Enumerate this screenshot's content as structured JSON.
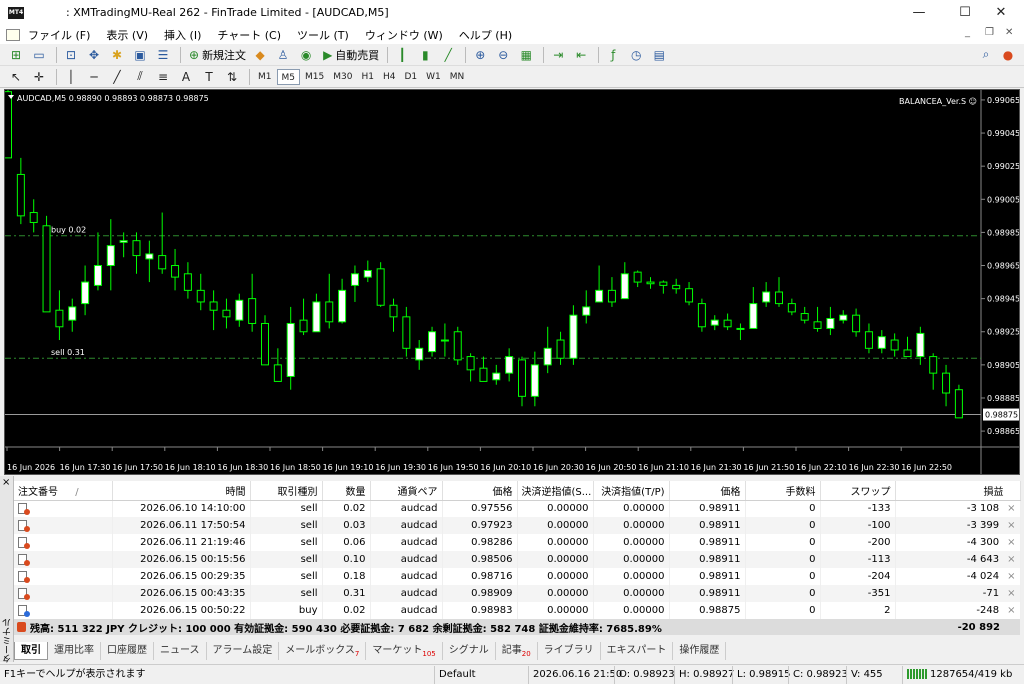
{
  "window": {
    "title": ": XMTradingMU-Real 262 - FinTrade Limited - [AUDCAD,M5]",
    "app_icon_text": "MT4",
    "controls": {
      "minimize": "—",
      "maximize": "☐",
      "close": "✕"
    }
  },
  "menu": [
    "ファイル (F)",
    "表示 (V)",
    "挿入 (I)",
    "チャート (C)",
    "ツール (T)",
    "ウィンドウ (W)",
    "ヘルプ (H)"
  ],
  "toolbar": {
    "new_order": "新規注文",
    "auto_trading": "自動売買",
    "timeframes": [
      "M1",
      "M5",
      "M15",
      "M30",
      "H1",
      "H4",
      "D1",
      "W1",
      "MN"
    ],
    "active_timeframe": "M5",
    "drawing_tool_A": "A"
  },
  "chart": {
    "header": "AUDCAD,M5  0.98890 0.98893 0.98873 0.98875",
    "ea_label": "BALANCEA_Ver.S ☺",
    "buy_label": "buy 0.02",
    "sell_label": "sell 0.31",
    "current_price_label": "0.98875",
    "colors": {
      "background": "#000000",
      "up": "#ffffff",
      "down": "#000000",
      "wick": "#00ff00",
      "level": "#2e8b2e",
      "text": "#ffffff"
    }
  },
  "chart_data": {
    "type": "candlestick",
    "symbol": "AUDCAD",
    "timeframe": "M5",
    "ylim": [
      0.98856,
      0.99071
    ],
    "y_ticks": [
      "0.99065",
      "0.99045",
      "0.99025",
      "0.99005",
      "0.98985",
      "0.98965",
      "0.98945",
      "0.98925",
      "0.98905",
      "0.98885",
      "0.98865"
    ],
    "x_ticks": [
      "16 Jun 2026",
      "16 Jun 17:30",
      "16 Jun 17:50",
      "16 Jun 18:10",
      "16 Jun 18:30",
      "16 Jun 18:50",
      "16 Jun 19:10",
      "16 Jun 19:30",
      "16 Jun 19:50",
      "16 Jun 20:10",
      "16 Jun 20:30",
      "16 Jun 20:50",
      "16 Jun 21:10",
      "16 Jun 21:30",
      "16 Jun 21:50",
      "16 Jun 22:10",
      "16 Jun 22:30",
      "16 Jun 22:50"
    ],
    "buy_level": 0.98983,
    "sell_level": 0.98909,
    "current_price": 0.98875,
    "candles": [
      [
        0.9907,
        0.9903,
        0.99071,
        0.9903
      ],
      [
        0.9902,
        0.98995,
        0.9903,
        0.9899
      ],
      [
        0.98997,
        0.98991,
        0.99005,
        0.98985
      ],
      [
        0.98989,
        0.98937,
        0.98995,
        0.98937
      ],
      [
        0.98938,
        0.98928,
        0.9895,
        0.9892
      ],
      [
        0.98932,
        0.9894,
        0.98945,
        0.98925
      ],
      [
        0.98942,
        0.98955,
        0.98965,
        0.98935
      ],
      [
        0.98953,
        0.98965,
        0.98985,
        0.9895
      ],
      [
        0.98965,
        0.98977,
        0.98993,
        0.9895
      ],
      [
        0.98979,
        0.9898,
        0.98985,
        0.9897
      ],
      [
        0.9898,
        0.98971,
        0.98985,
        0.9896
      ],
      [
        0.98969,
        0.98972,
        0.9898,
        0.98955
      ],
      [
        0.98971,
        0.98963,
        0.98997,
        0.9896
      ],
      [
        0.98965,
        0.98958,
        0.98975,
        0.9895
      ],
      [
        0.9896,
        0.9895,
        0.98967,
        0.98945
      ],
      [
        0.9895,
        0.98943,
        0.9896,
        0.98938
      ],
      [
        0.98943,
        0.98938,
        0.9895,
        0.98926
      ],
      [
        0.98938,
        0.98934,
        0.98945,
        0.98927
      ],
      [
        0.98932,
        0.98944,
        0.98948,
        0.98928
      ],
      [
        0.98945,
        0.9893,
        0.9896,
        0.98925
      ],
      [
        0.9893,
        0.98905,
        0.98935,
        0.98905
      ],
      [
        0.98905,
        0.98895,
        0.98915,
        0.98895
      ],
      [
        0.98898,
        0.9893,
        0.9894,
        0.9889
      ],
      [
        0.98932,
        0.98925,
        0.98945,
        0.98923
      ],
      [
        0.98925,
        0.98943,
        0.98948,
        0.98925
      ],
      [
        0.98943,
        0.98931,
        0.9896,
        0.98927
      ],
      [
        0.98931,
        0.9895,
        0.98957,
        0.9893
      ],
      [
        0.98953,
        0.9896,
        0.98965,
        0.98943
      ],
      [
        0.98958,
        0.98962,
        0.98968,
        0.98955
      ],
      [
        0.98963,
        0.98941,
        0.98967,
        0.9894
      ],
      [
        0.98941,
        0.98934,
        0.98945,
        0.98925
      ],
      [
        0.98934,
        0.98915,
        0.9894,
        0.9891
      ],
      [
        0.98908,
        0.98915,
        0.9892,
        0.98902
      ],
      [
        0.98913,
        0.98925,
        0.98928,
        0.9891
      ],
      [
        0.9892,
        0.9892,
        0.9893,
        0.9891
      ],
      [
        0.98925,
        0.98908,
        0.98928,
        0.98905
      ],
      [
        0.9891,
        0.98902,
        0.98912,
        0.98895
      ],
      [
        0.98903,
        0.98895,
        0.9891,
        0.98895
      ],
      [
        0.98896,
        0.989,
        0.98905,
        0.98893
      ],
      [
        0.989,
        0.9891,
        0.98915,
        0.98895
      ],
      [
        0.98908,
        0.98886,
        0.9891,
        0.9888
      ],
      [
        0.98886,
        0.98905,
        0.98913,
        0.9888
      ],
      [
        0.98905,
        0.98915,
        0.98928,
        0.989
      ],
      [
        0.9892,
        0.98909,
        0.98925,
        0.98905
      ],
      [
        0.98909,
        0.98935,
        0.98941,
        0.98905
      ],
      [
        0.98935,
        0.9894,
        0.9895,
        0.9893
      ],
      [
        0.98943,
        0.9895,
        0.98965,
        0.98943
      ],
      [
        0.9895,
        0.98943,
        0.98958,
        0.9894
      ],
      [
        0.98945,
        0.9896,
        0.98967,
        0.98945
      ],
      [
        0.98961,
        0.98955,
        0.98962,
        0.98952
      ],
      [
        0.98955,
        0.98954,
        0.98958,
        0.98951
      ],
      [
        0.98955,
        0.98953,
        0.98956,
        0.98948
      ],
      [
        0.98953,
        0.98951,
        0.98957,
        0.98948
      ],
      [
        0.98951,
        0.98943,
        0.98955,
        0.98941
      ],
      [
        0.98942,
        0.98928,
        0.98945,
        0.98925
      ],
      [
        0.98929,
        0.98932,
        0.98935,
        0.98926
      ],
      [
        0.98932,
        0.98928,
        0.98936,
        0.98926
      ],
      [
        0.98927,
        0.98927,
        0.9893,
        0.9892
      ],
      [
        0.98927,
        0.98942,
        0.98952,
        0.98927
      ],
      [
        0.98943,
        0.98949,
        0.98955,
        0.9894
      ],
      [
        0.98949,
        0.98942,
        0.98958,
        0.9894
      ],
      [
        0.98942,
        0.98937,
        0.98945,
        0.98935
      ],
      [
        0.98936,
        0.98932,
        0.9894,
        0.9893
      ],
      [
        0.98931,
        0.98927,
        0.9894,
        0.98925
      ],
      [
        0.98927,
        0.98933,
        0.9894,
        0.98923
      ],
      [
        0.98932,
        0.98935,
        0.98938,
        0.9893
      ],
      [
        0.98935,
        0.98925,
        0.98939,
        0.98922
      ],
      [
        0.98925,
        0.98915,
        0.9893,
        0.98912
      ],
      [
        0.98915,
        0.98922,
        0.98926,
        0.98912
      ],
      [
        0.9892,
        0.98914,
        0.98924,
        0.9891
      ],
      [
        0.98914,
        0.9891,
        0.98922,
        0.9891
      ],
      [
        0.9891,
        0.98924,
        0.98928,
        0.98905
      ],
      [
        0.9891,
        0.989,
        0.98912,
        0.9889
      ],
      [
        0.989,
        0.98888,
        0.98905,
        0.9888
      ],
      [
        0.9889,
        0.98873,
        0.98893,
        0.98873
      ]
    ]
  },
  "terminal": {
    "columns": [
      "注文番号",
      "時間",
      "取引種別",
      "数量",
      "通貨ペア",
      "価格",
      "決済逆指値(S...",
      "決済指値(T/P)",
      "価格",
      "手数料",
      "スワップ",
      "損益"
    ],
    "sort_marker": "/",
    "orders": [
      {
        "time": "2026.06.10 14:10:00",
        "type": "sell",
        "size": "0.02",
        "symbol": "audcad",
        "price": "0.97556",
        "sl": "0.00000",
        "tp": "0.00000",
        "cur": "0.98911",
        "commission": "0",
        "swap": "-133",
        "profit": "-3 108"
      },
      {
        "time": "2026.06.11 17:50:54",
        "type": "sell",
        "size": "0.03",
        "symbol": "audcad",
        "price": "0.97923",
        "sl": "0.00000",
        "tp": "0.00000",
        "cur": "0.98911",
        "commission": "0",
        "swap": "-100",
        "profit": "-3 399"
      },
      {
        "time": "2026.06.11 21:19:46",
        "type": "sell",
        "size": "0.06",
        "symbol": "audcad",
        "price": "0.98286",
        "sl": "0.00000",
        "tp": "0.00000",
        "cur": "0.98911",
        "commission": "0",
        "swap": "-200",
        "profit": "-4 300"
      },
      {
        "time": "2026.06.15 00:15:56",
        "type": "sell",
        "size": "0.10",
        "symbol": "audcad",
        "price": "0.98506",
        "sl": "0.00000",
        "tp": "0.00000",
        "cur": "0.98911",
        "commission": "0",
        "swap": "-113",
        "profit": "-4 643"
      },
      {
        "time": "2026.06.15 00:29:35",
        "type": "sell",
        "size": "0.18",
        "symbol": "audcad",
        "price": "0.98716",
        "sl": "0.00000",
        "tp": "0.00000",
        "cur": "0.98911",
        "commission": "0",
        "swap": "-204",
        "profit": "-4 024"
      },
      {
        "time": "2026.06.15 00:43:35",
        "type": "sell",
        "size": "0.31",
        "symbol": "audcad",
        "price": "0.98909",
        "sl": "0.00000",
        "tp": "0.00000",
        "cur": "0.98911",
        "commission": "0",
        "swap": "-351",
        "profit": "-71"
      },
      {
        "time": "2026.06.15 00:50:22",
        "type": "buy",
        "size": "0.02",
        "symbol": "audcad",
        "price": "0.98983",
        "sl": "0.00000",
        "tp": "0.00000",
        "cur": "0.98875",
        "commission": "0",
        "swap": "2",
        "profit": "-248"
      }
    ],
    "summary": "残高: 511 322 JPY  クレジット: 100 000  有効証拠金: 590 430  必要証拠金: 7 682  余剰証拠金: 582 748  証拠金維持率: 7685.89%",
    "summary_profit": "-20 892",
    "side_label": "ターミナル",
    "close_glyph": "×",
    "row_close_glyph": "×"
  },
  "tabs": [
    {
      "label": "取引",
      "badge": ""
    },
    {
      "label": "運用比率",
      "badge": ""
    },
    {
      "label": "口座履歴",
      "badge": ""
    },
    {
      "label": "ニュース",
      "badge": ""
    },
    {
      "label": "アラーム設定",
      "badge": ""
    },
    {
      "label": "メールボックス",
      "badge": "7"
    },
    {
      "label": "マーケット",
      "badge": "105"
    },
    {
      "label": "シグナル",
      "badge": ""
    },
    {
      "label": "記事",
      "badge": "20"
    },
    {
      "label": "ライブラリ",
      "badge": ""
    },
    {
      "label": "エキスパート",
      "badge": ""
    },
    {
      "label": "操作履歴",
      "badge": ""
    }
  ],
  "statusbar": {
    "help": "F1キーでヘルプが表示されます",
    "profile": "Default",
    "datetime": "2026.06.16 21:50",
    "open": "O: 0.98923",
    "high": "H: 0.98927",
    "low": "L: 0.98915",
    "close": "C: 0.98923",
    "volume": "V: 455",
    "traffic": "1287654/419 kb"
  }
}
